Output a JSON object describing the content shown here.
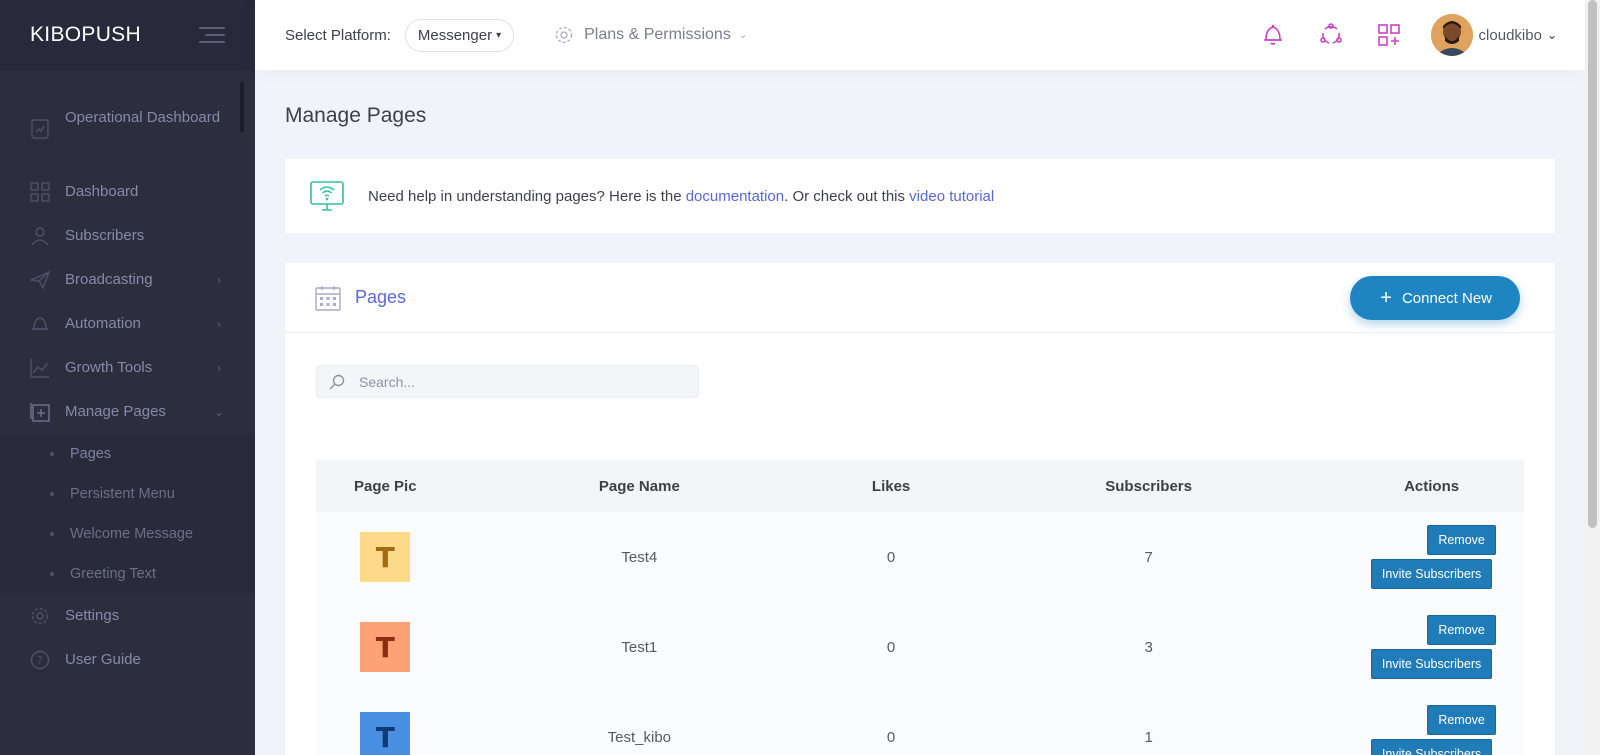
{
  "app": {
    "brand": "KIBOPUSH"
  },
  "sidebar": {
    "items": [
      {
        "label": "Operational Dashboard",
        "icon": "chart-doc-icon",
        "has_arrow": false
      },
      {
        "label": "Dashboard",
        "icon": "grid-icon",
        "has_arrow": false
      },
      {
        "label": "Subscribers",
        "icon": "user-icon",
        "has_arrow": false
      },
      {
        "label": "Broadcasting",
        "icon": "send-icon",
        "has_arrow": true
      },
      {
        "label": "Automation",
        "icon": "bell-icon",
        "has_arrow": true
      },
      {
        "label": "Growth Tools",
        "icon": "line-chart-icon",
        "has_arrow": true
      },
      {
        "label": "Manage Pages",
        "icon": "add-page-icon",
        "has_arrow": true,
        "expanded": true
      },
      {
        "label": "Settings",
        "icon": "gear-icon",
        "has_arrow": false
      },
      {
        "label": "User Guide",
        "icon": "help-icon",
        "has_arrow": false
      }
    ],
    "submenu": [
      "Pages",
      "Persistent Menu",
      "Welcome Message",
      "Greeting Text"
    ]
  },
  "header": {
    "platform_label": "Select Platform:",
    "platform_value": "Messenger",
    "plans_label": "Plans & Permissions",
    "username": "cloudkibo"
  },
  "main": {
    "title": "Manage Pages",
    "help": {
      "prefix": "Need help in understanding pages? Here is the ",
      "doc_link": "documentation",
      "middle": ". Or check out this ",
      "video_link": "video tutorial"
    },
    "portlet_title": "Pages",
    "connect_button": "Connect New",
    "search_placeholder": "Search...",
    "table": {
      "headers": [
        "Page Pic",
        "Page Name",
        "Likes",
        "Subscribers",
        "Actions"
      ],
      "rows": [
        {
          "letter": "T",
          "name": "Test4",
          "likes": "0",
          "subscribers": "7",
          "bg": "#fdd98a",
          "fg": "#a36b12"
        },
        {
          "letter": "T",
          "name": "Test1",
          "likes": "0",
          "subscribers": "3",
          "bg": "#fca276",
          "fg": "#8f2c10"
        },
        {
          "letter": "T",
          "name": "Test_kibo",
          "likes": "0",
          "subscribers": "1",
          "bg": "#4a90e2",
          "fg": "#0e3a75"
        }
      ],
      "remove_label": "Remove",
      "invite_label": "Invite Subscribers"
    }
  },
  "colors": {
    "accent": "#5867dd",
    "primary_button": "#1f84c2",
    "sidebar_bg": "#2c2e3e",
    "icon_magenta": "#c944c4"
  }
}
